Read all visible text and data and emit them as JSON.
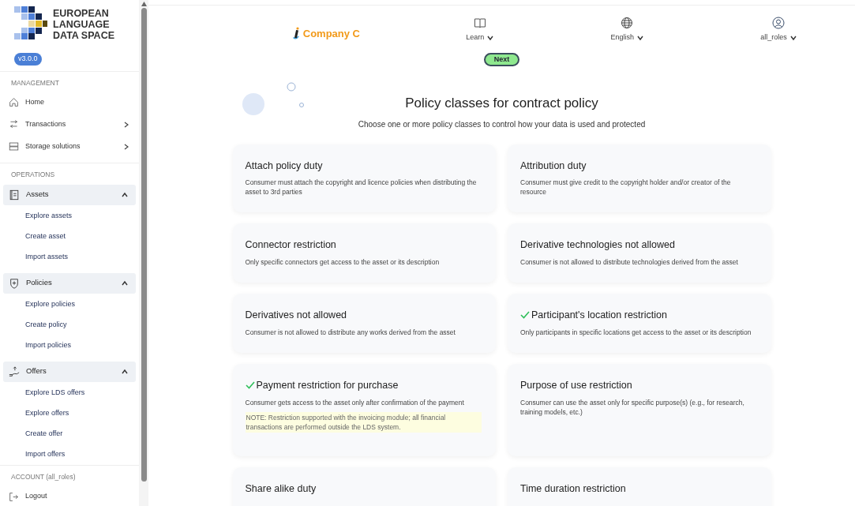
{
  "sidebar": {
    "logo_lines": [
      "EUROPEAN",
      "LANGUAGE",
      "DATA SPACE"
    ],
    "version": "v3.0.0",
    "sections": [
      {
        "heading": "MANAGEMENT",
        "items": [
          {
            "label": "Home",
            "has_submenu": false
          },
          {
            "label": "Transactions",
            "has_submenu": true
          },
          {
            "label": "Storage solutions",
            "has_submenu": true
          }
        ]
      },
      {
        "heading": "OPERATIONS",
        "groups": [
          {
            "label": "Assets",
            "expanded": true,
            "children": [
              "Explore assets",
              "Create asset",
              "Import assets"
            ]
          },
          {
            "label": "Policies",
            "expanded": true,
            "children": [
              "Explore policies",
              "Create policy",
              "Import policies"
            ]
          },
          {
            "label": "Offers",
            "expanded": true,
            "children": [
              "Explore LDS offers",
              "Explore offers",
              "Create offer",
              "Import offers"
            ]
          }
        ]
      },
      {
        "heading": "ACCOUNT (all_roles)",
        "items": [
          {
            "label": "Logout",
            "has_submenu": false
          }
        ]
      }
    ]
  },
  "header": {
    "company": "Company C",
    "menus": [
      {
        "label": "Learn"
      },
      {
        "label": "English"
      },
      {
        "label": "all_roles"
      }
    ]
  },
  "next_button": "Next",
  "title": "Policy classes for contract policy",
  "subtitle": "Choose one or more policy classes to control how your data is used and protected",
  "policies": [
    {
      "title": "Attach policy duty",
      "description": "Consumer must attach the copyright and licence policies when distributing the asset to 3rd parties",
      "selected": false
    },
    {
      "title": "Attribution duty",
      "description": "Consumer must give credit to the copyright holder and/or creator of the resource",
      "selected": false
    },
    {
      "title": "Connector restriction",
      "description": "Only specific connectors get access to the asset or its description",
      "selected": false
    },
    {
      "title": "Derivative technologies not allowed",
      "description": "Consumer is not allowed to distribute technologies derived from the asset",
      "selected": false
    },
    {
      "title": "Derivatives not allowed",
      "description": "Consumer is not allowed to distribute any works derived from the asset",
      "selected": false
    },
    {
      "title": "Participant's location restriction",
      "description": "Only participants in specific locations get access to the asset or its description",
      "selected": true
    },
    {
      "title": "Payment restriction for purchase",
      "description": "Consumer gets access to the asset only after confirmation of the payment",
      "note": "NOTE: Restriction supported with the invoicing module; all financial transactions are performed outside the LDS system.",
      "selected": true
    },
    {
      "title": "Purpose of use restriction",
      "description": "Consumer can use the asset only for specific purpose(s)  (e.g., for research, training models, etc.)",
      "selected": false
    },
    {
      "title": "Share alike duty",
      "selected": false
    },
    {
      "title": "Time duration restriction",
      "selected": false
    }
  ]
}
